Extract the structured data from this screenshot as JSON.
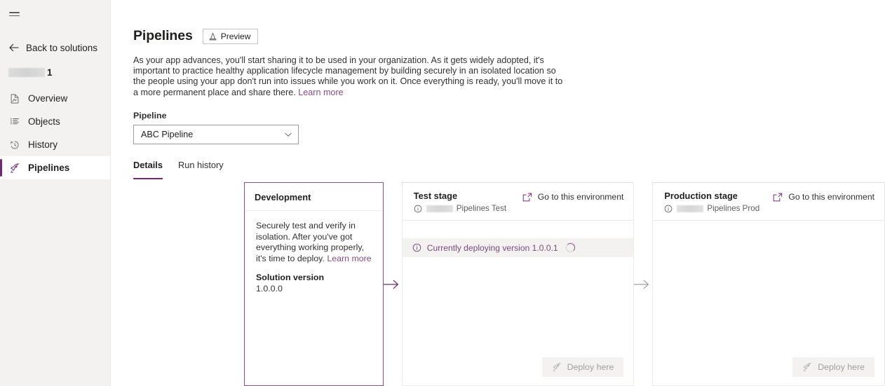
{
  "sidebar": {
    "menu_icon": "hamburger-icon",
    "back_label": "Back to solutions",
    "solution_redacted": true,
    "solution_suffix": "1",
    "items": [
      {
        "label": "Overview",
        "icon": "overview-icon",
        "selected": false
      },
      {
        "label": "Objects",
        "icon": "objects-list-icon",
        "selected": false
      },
      {
        "label": "History",
        "icon": "history-clock-icon",
        "selected": false
      },
      {
        "label": "Pipelines",
        "icon": "rocket-icon",
        "selected": true
      }
    ]
  },
  "header": {
    "title": "Pipelines",
    "preview_badge": "Preview",
    "preview_icon": "traffic-cone-icon",
    "description": "As your app advances, you'll start sharing it to be used in your organization. As it gets widely adopted, it's important to practice healthy application lifecycle management by building securely in an isolated location so the people using your app don't run into issues while you work on it. Once everything is ready, you'll move it to a more permanent place and share there.",
    "learn_more": "Learn more"
  },
  "pipeline_field": {
    "label": "Pipeline",
    "selected_value": "ABC Pipeline",
    "chevron_icon": "chevron-down-icon"
  },
  "tabs": [
    {
      "label": "Details",
      "active": true
    },
    {
      "label": "Run history",
      "active": false
    }
  ],
  "stages": {
    "development": {
      "name": "Development",
      "body_text": "Securely test and verify in isolation. After you've got everything working properly, it's time to deploy.",
      "learn_more": "Learn more",
      "solution_version_label": "Solution version",
      "solution_version_value": "1.0.0.0"
    },
    "test": {
      "name": "Test stage",
      "env_name": "Pipelines Test",
      "env_icon": "info-circle-icon",
      "goto_label": "Go to this environment",
      "goto_icon": "external-link-icon",
      "status_icon": "info-circle-icon",
      "status_text": "Currently deploying version 1.0.0.1",
      "spinner_icon": "spinner-icon",
      "deploy_label": "Deploy here",
      "deploy_icon": "rocket-icon",
      "deploy_disabled": true
    },
    "production": {
      "name": "Production stage",
      "env_name": "Pipelines Prod",
      "env_icon": "info-circle-icon",
      "goto_label": "Go to this environment",
      "goto_icon": "external-link-icon",
      "deploy_label": "Deploy here",
      "deploy_icon": "rocket-icon",
      "deploy_disabled": true
    }
  },
  "colors": {
    "accent": "#742774",
    "link": "#8a4b8a",
    "sidebar_bg": "#f3f2f1",
    "status_bg": "#f3f2f1",
    "active_card_border": "#8c4f8c",
    "arrow_active": "#742774",
    "arrow_inactive": "#a19f9d"
  }
}
